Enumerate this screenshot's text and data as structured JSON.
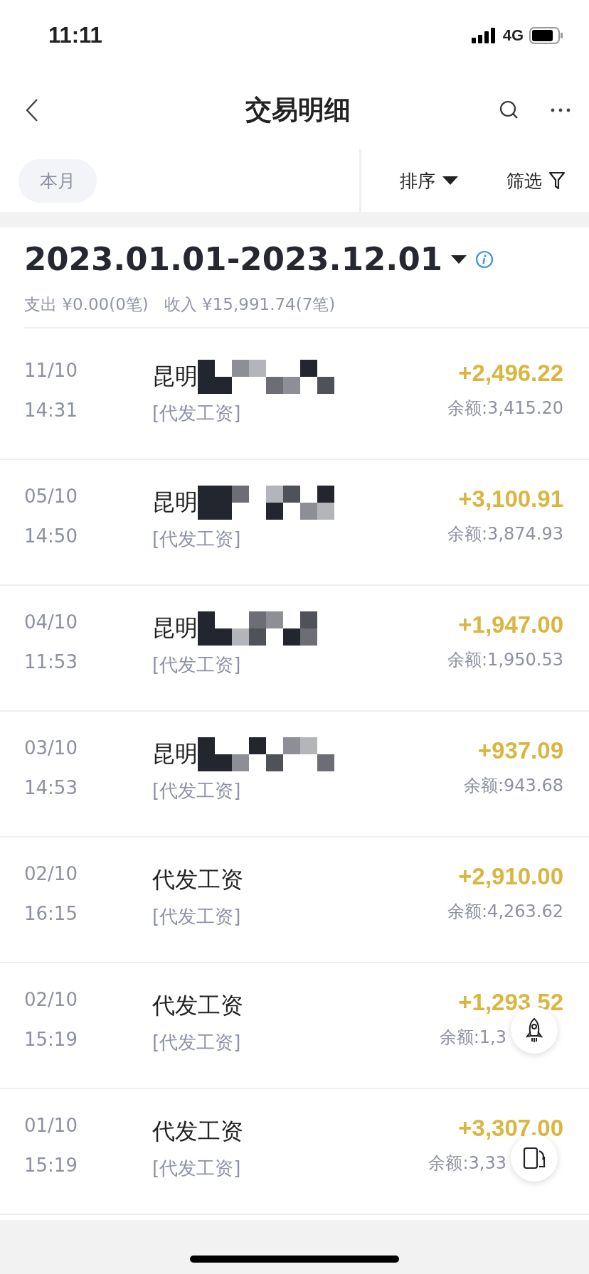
{
  "status_bar": {
    "time": "11:11",
    "network": "4G"
  },
  "nav": {
    "title": "交易明细"
  },
  "filters": {
    "period": "本月",
    "sort": "排序",
    "filter": "筛选"
  },
  "summary": {
    "range": "2023.01.01-2023.12.01",
    "expense": "支出 ¥0.00(0笔)",
    "income": "收入 ¥15,991.74(7笔)"
  },
  "rows": [
    {
      "date": "11/10",
      "time": "14:31",
      "name": "昆明",
      "redacted": true,
      "category": "[代发工资]",
      "amount": "+2,496.22",
      "balance": "余额:3,415.20"
    },
    {
      "date": "05/10",
      "time": "14:50",
      "name": "昆明",
      "redacted": true,
      "category": "[代发工资]",
      "amount": "+3,100.91",
      "balance": "余额:3,874.93"
    },
    {
      "date": "04/10",
      "time": "11:53",
      "name": "昆明",
      "redacted": true,
      "category": "[代发工资]",
      "amount": "+1,947.00",
      "balance": "余额:1,950.53"
    },
    {
      "date": "03/10",
      "time": "14:53",
      "name": "昆明",
      "redacted": true,
      "category": "[代发工资]",
      "amount": "+937.09",
      "balance": "余额:943.68"
    },
    {
      "date": "02/10",
      "time": "16:15",
      "name": "代发工资",
      "redacted": false,
      "category": "[代发工资]",
      "amount": "+2,910.00",
      "balance": "余额:4,263.62"
    },
    {
      "date": "02/10",
      "time": "15:19",
      "name": "代发工资",
      "redacted": false,
      "category": "[代发工资]",
      "amount": "+1,293.52",
      "balance": "余额:1,3"
    },
    {
      "date": "01/10",
      "time": "15:19",
      "name": "代发工资",
      "redacted": false,
      "category": "[代发工资]",
      "amount": "+3,307.00",
      "balance": "余额:3,33"
    }
  ]
}
